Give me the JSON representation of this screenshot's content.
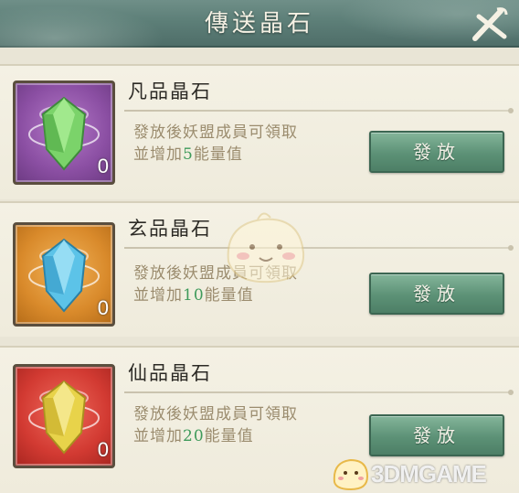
{
  "header": {
    "title": "傳送晶石",
    "close_icon": "close-icon"
  },
  "items": [
    {
      "name": "凡品晶石",
      "desc_line1": "發放後妖盟成員可領取",
      "desc_prefix": "並增加",
      "desc_value": "5",
      "desc_suffix": "能量值",
      "count": "0",
      "button_label": "發放",
      "icon": "green-crystal-icon",
      "frame_color": "#8b4fa3",
      "crystal_color": "#7bd36a"
    },
    {
      "name": "玄品晶石",
      "desc_line1": "發放後妖盟成員可領取",
      "desc_prefix": "並增加",
      "desc_value": "10",
      "desc_suffix": "能量值",
      "count": "0",
      "button_label": "發放",
      "icon": "blue-crystal-icon",
      "frame_color": "#d98a2b",
      "crystal_color": "#5cc3e8"
    },
    {
      "name": "仙品晶石",
      "desc_line1": "發放後妖盟成員可領取",
      "desc_prefix": "並增加",
      "desc_value": "20",
      "desc_suffix": "能量值",
      "count": "0",
      "button_label": "發放",
      "icon": "yellow-crystal-icon",
      "frame_color": "#d23a32",
      "crystal_color": "#e8d34a"
    }
  ],
  "watermark": {
    "text": "3DMGAME"
  }
}
